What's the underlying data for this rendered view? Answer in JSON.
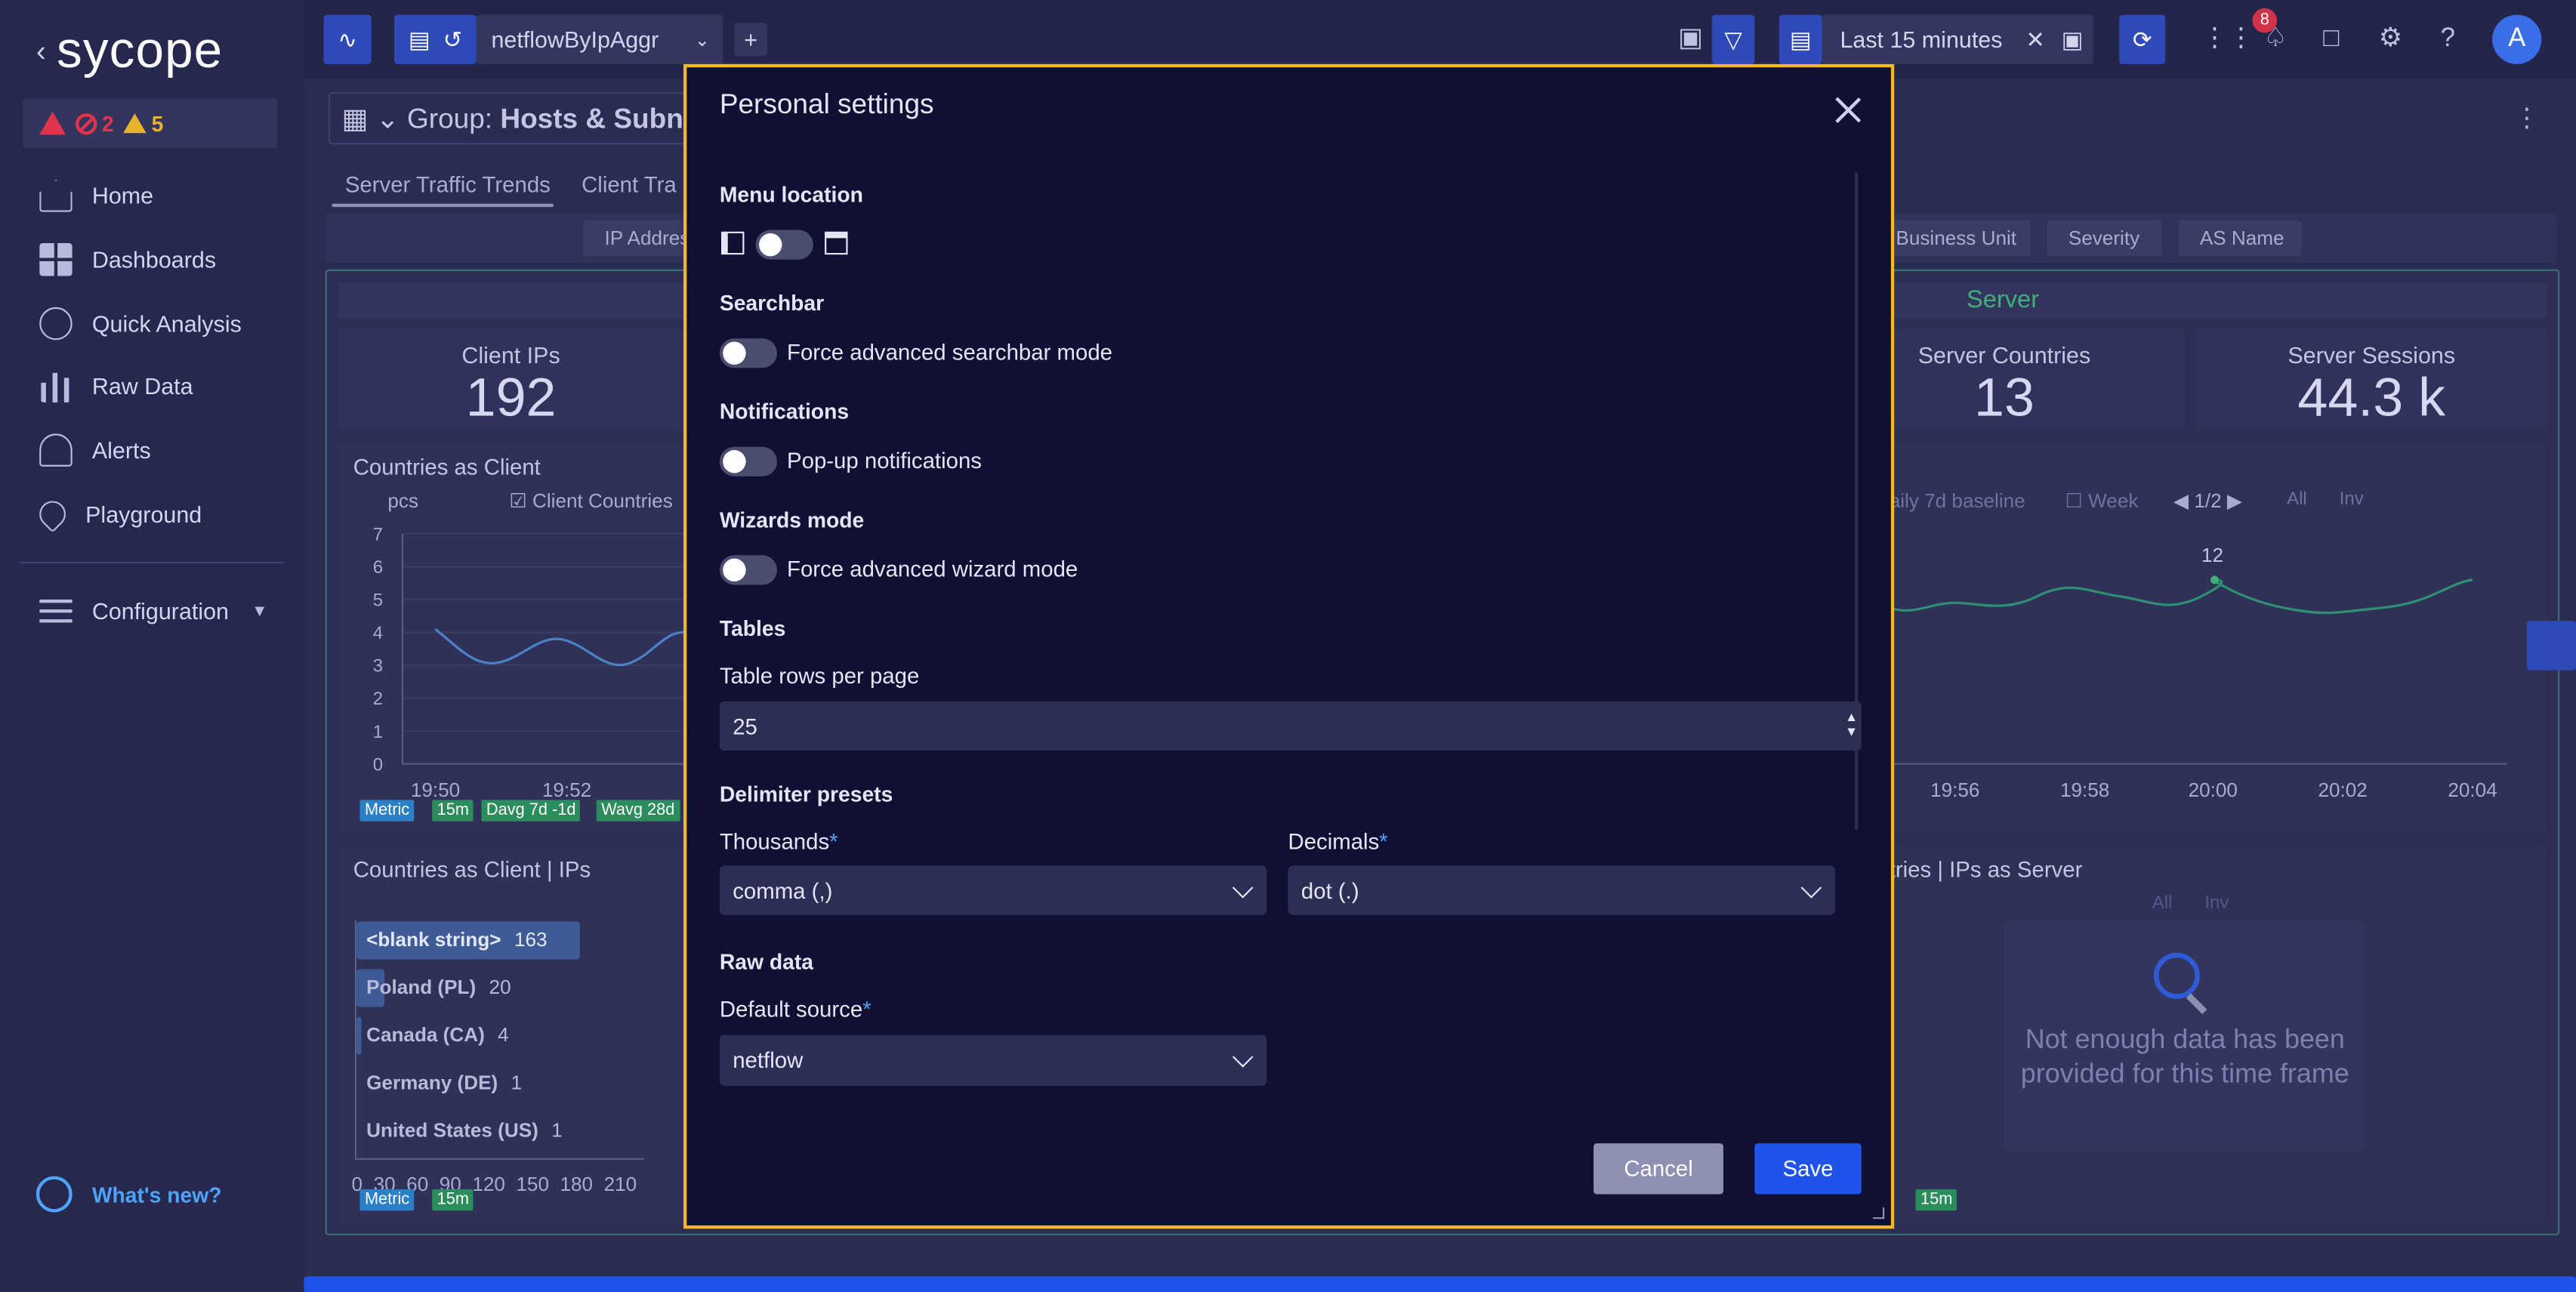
{
  "app": {
    "logo": "sycope"
  },
  "alerts": {
    "errors": "2",
    "warnings": "5"
  },
  "sidebar": {
    "items": [
      {
        "label": "Home",
        "icon": "home-icon"
      },
      {
        "label": "Dashboards",
        "icon": "dashboards-icon"
      },
      {
        "label": "Quick Analysis",
        "icon": "quick-analysis-icon"
      },
      {
        "label": "Raw Data",
        "icon": "raw-data-icon"
      },
      {
        "label": "Alerts",
        "icon": "alerts-icon"
      },
      {
        "label": "Playground",
        "icon": "playground-icon"
      }
    ],
    "configuration": "Configuration",
    "whats_new": "What's new?"
  },
  "topbar": {
    "source": "netflowByIpAggr",
    "time_range": "Last 15 minutes",
    "notifications_count": "8",
    "avatar": "A"
  },
  "background": {
    "group_label": "Group:",
    "group_value": "Hosts & Subne",
    "tabs": [
      "Server Traffic Trends",
      "Client Tra"
    ],
    "filter_chips": [
      "IP Addres",
      "Business Unit",
      "Severity",
      "AS Name"
    ],
    "server_header": "Server",
    "kpis": [
      {
        "label": "Client IPs",
        "value": "192"
      },
      {
        "label": "Server Countries",
        "value": "13"
      },
      {
        "label": "Server Sessions",
        "value": "44.3 k"
      }
    ],
    "countries_as_client": "Countries as Client",
    "pcs": "pcs",
    "legend_client_countries": "Client Countries",
    "baseline": "aily 7d baseline",
    "week": "Week",
    "pager": "1/2",
    "all": "All",
    "inv": "Inv",
    "y_ticks": [
      "7",
      "6",
      "5",
      "4",
      "3",
      "2",
      "1",
      "0"
    ],
    "x_ticks_left": [
      "19:50",
      "19:52"
    ],
    "x_ticks_right": [
      "19:56",
      "19:58",
      "20:00",
      "20:02",
      "20:04"
    ],
    "peak_label": "12",
    "tags_left": [
      "Metric",
      "15m",
      "Davg 7d -1d",
      "Wavg 28d"
    ],
    "countries_ips_client": "Countries as Client | IPs",
    "countries_ips_server": "tries | IPs as Server",
    "bars": [
      {
        "label": "<blank string>",
        "count": "163"
      },
      {
        "label": "Poland (PL)",
        "count": "20"
      },
      {
        "label": "Canada (CA)",
        "count": "4"
      },
      {
        "label": "Germany (DE)",
        "count": "1"
      },
      {
        "label": "United States (US)",
        "count": "1"
      }
    ],
    "bar_axis": [
      "0",
      "30",
      "60",
      "90",
      "120",
      "150",
      "180",
      "210"
    ],
    "tags_bottom": [
      "Metric",
      "15m"
    ],
    "tags_bottom_right": [
      "15m"
    ],
    "no_data": "Not enough data has been provided for this time frame"
  },
  "modal": {
    "title": "Personal settings",
    "menu_location": "Menu location",
    "searchbar": "Searchbar",
    "searchbar_toggle": "Force advanced searchbar mode",
    "notifications": "Notifications",
    "notifications_toggle": "Pop-up notifications",
    "wizards": "Wizards mode",
    "wizards_toggle": "Force advanced wizard mode",
    "tables": "Tables",
    "rows_label": "Table rows per page",
    "rows_value": "25",
    "delimiter": "Delimiter presets",
    "thousands_label": "Thousands",
    "thousands_value": "comma (,)",
    "decimals_label": "Decimals",
    "decimals_value": "dot (.)",
    "raw_data": "Raw data",
    "default_source_label": "Default source",
    "default_source_value": "netflow",
    "required_mark": "*",
    "cancel": "Cancel",
    "save": "Save"
  }
}
